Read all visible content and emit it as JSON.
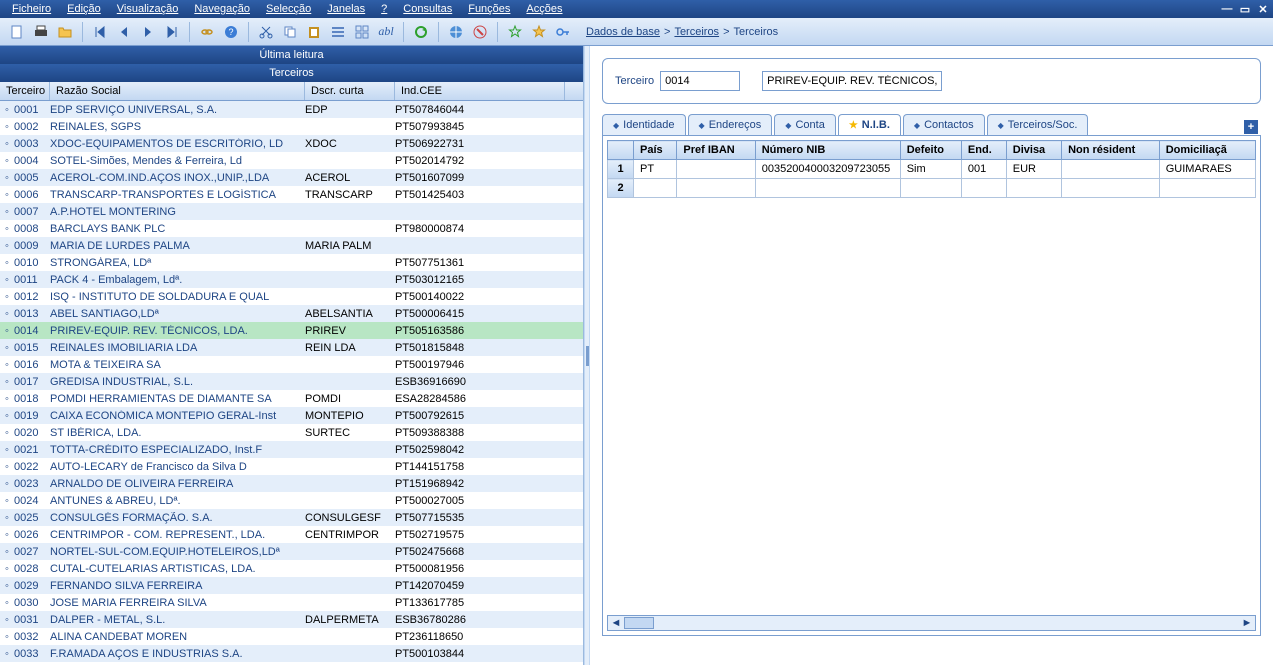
{
  "menubar": {
    "items": [
      "Ficheiro",
      "Edição",
      "Visualização",
      "Navegação",
      "Selecção",
      "Janelas",
      "?",
      "Consultas",
      "Funções",
      "Acções"
    ]
  },
  "breadcrumb": {
    "root": "Dados de base",
    "mid": "Terceiros",
    "leaf": "Terceiros"
  },
  "left": {
    "title_last": "Última leitura",
    "title_main": "Terceiros",
    "headers": {
      "id": "Terceiro",
      "name": "Razão Social",
      "short": "Dscr. curta",
      "ind": "Ind.CEE"
    }
  },
  "rows": [
    {
      "id": "0001",
      "name": "EDP SERVIÇO UNIVERSAL, S.A.",
      "short": "EDP",
      "ind": "PT507846044"
    },
    {
      "id": "0002",
      "name": "REINALES, SGPS",
      "short": "",
      "ind": "PT507993845"
    },
    {
      "id": "0003",
      "name": "XDOC-EQUIPAMENTOS DE ESCRITÓRIO, LD",
      "short": "XDOC",
      "ind": "PT506922731"
    },
    {
      "id": "0004",
      "name": "SOTEL-Simões, Mendes & Ferreira, Ld",
      "short": "",
      "ind": "PT502014792"
    },
    {
      "id": "0005",
      "name": "ACEROL-COM.IND.AÇOS INOX.,UNIP.,LDA",
      "short": "ACEROL",
      "ind": "PT501607099"
    },
    {
      "id": "0006",
      "name": "TRANSCARP-TRANSPORTES E LOGÍSTICA",
      "short": "TRANSCARP",
      "ind": "PT501425403"
    },
    {
      "id": "0007",
      "name": "A.P.HOTEL MONTERING",
      "short": "",
      "ind": ""
    },
    {
      "id": "0008",
      "name": "BARCLAYS BANK PLC",
      "short": "",
      "ind": "PT980000874"
    },
    {
      "id": "0009",
      "name": "MARIA DE LURDES PALMA",
      "short": "MARIA PALM",
      "ind": ""
    },
    {
      "id": "0010",
      "name": "STRONGÁREA, LDª",
      "short": "",
      "ind": "PT507751361"
    },
    {
      "id": "0011",
      "name": "PACK  4 - Embalagem, Ldª.",
      "short": "",
      "ind": "PT503012165"
    },
    {
      "id": "0012",
      "name": "ISQ - INSTITUTO DE SOLDADURA E QUAL",
      "short": "",
      "ind": "PT500140022"
    },
    {
      "id": "0013",
      "name": "ABEL SANTIAGO,LDª",
      "short": "ABELSANTIA",
      "ind": "PT500006415"
    },
    {
      "id": "0014",
      "name": "PRIREV-EQUIP. REV. TÉCNICOS, LDA.",
      "short": "PRIREV",
      "ind": "PT505163586",
      "selected": true
    },
    {
      "id": "0015",
      "name": "REINALES IMOBILIARIA LDA",
      "short": "REIN LDA",
      "ind": "PT501815848"
    },
    {
      "id": "0016",
      "name": "MOTA & TEIXEIRA SA",
      "short": "",
      "ind": "PT500197946"
    },
    {
      "id": "0017",
      "name": "GREDISA INDUSTRIAL, S.L.",
      "short": "",
      "ind": "ESB36916690"
    },
    {
      "id": "0018",
      "name": "POMDI HERRAMIENTAS DE DIAMANTE SA",
      "short": "POMDI",
      "ind": "ESA28284586"
    },
    {
      "id": "0019",
      "name": "CAIXA ECONÓMICA MONTEPIO GERAL-Inst",
      "short": "MONTEPIO",
      "ind": "PT500792615"
    },
    {
      "id": "0020",
      "name": "ST IBÉRICA, LDA.",
      "short": "SURTEC",
      "ind": "PT509388388"
    },
    {
      "id": "0021",
      "name": "TOTTA-CRÉDITO ESPECIALIZADO, Inst.F",
      "short": "",
      "ind": "PT502598042"
    },
    {
      "id": "0022",
      "name": "AUTO-LECARY de Francisco da Silva D",
      "short": "",
      "ind": "PT144151758"
    },
    {
      "id": "0023",
      "name": "ARNALDO DE OLIVEIRA FERREIRA",
      "short": "",
      "ind": "PT151968942"
    },
    {
      "id": "0024",
      "name": "ANTUNES & ABREU, LDª.",
      "short": "",
      "ind": "PT500027005"
    },
    {
      "id": "0025",
      "name": "CONSULGÉS FORMAÇÃO. S.A.",
      "short": "CONSULGESF",
      "ind": "PT507715535"
    },
    {
      "id": "0026",
      "name": "CENTRIMPOR - COM. REPRESENT., LDA.",
      "short": "CENTRIMPOR",
      "ind": "PT502719575"
    },
    {
      "id": "0027",
      "name": "NORTEL-SUL-COM.EQUIP.HOTELEIROS,LDª",
      "short": "",
      "ind": "PT502475668"
    },
    {
      "id": "0028",
      "name": "CUTAL-CUTELARIAS ARTISTICAS, LDA.",
      "short": "",
      "ind": "PT500081956"
    },
    {
      "id": "0029",
      "name": "FERNANDO SILVA FERREIRA",
      "short": "",
      "ind": "PT142070459"
    },
    {
      "id": "0030",
      "name": "JOSE MARIA FERREIRA SILVA",
      "short": "",
      "ind": "PT133617785"
    },
    {
      "id": "0031",
      "name": "DALPER - METAL, S.L.",
      "short": "DALPERMETA",
      "ind": "ESB36780286"
    },
    {
      "id": "0032",
      "name": "ALINA CANDEBAT MOREN",
      "short": "",
      "ind": "PT236118650"
    },
    {
      "id": "0033",
      "name": "F.RAMADA  AÇOS E INDUSTRIAS  S.A.",
      "short": "",
      "ind": "PT500103844"
    }
  ],
  "form": {
    "label_terceiro": "Terceiro",
    "code": "0014",
    "desc": "PRIREV-EQUIP. REV. TÉCNICOS,"
  },
  "tabs": {
    "t0": "Identidade",
    "t1": "Endereços",
    "t2": "Conta",
    "t3": "N.I.B.",
    "t4": "Contactos",
    "t5": "Terceiros/Soc."
  },
  "grid": {
    "headers": {
      "pais": "País",
      "pref": "Pref IBAN",
      "nib": "Número NIB",
      "defeito": "Defeito",
      "end": "End.",
      "divisa": "Divisa",
      "nonres": "Non résident",
      "dom": "Domiciliaçã"
    },
    "rows": [
      {
        "n": "1",
        "pais": "PT",
        "pref": "",
        "nib": "003520040003209723055",
        "defeito": "Sim",
        "end": "001",
        "divisa": "EUR",
        "nonres": "",
        "dom": "GUIMARAES"
      },
      {
        "n": "2",
        "pais": "",
        "pref": "",
        "nib": "",
        "defeito": "",
        "end": "",
        "divisa": "",
        "nonres": "",
        "dom": ""
      }
    ]
  }
}
